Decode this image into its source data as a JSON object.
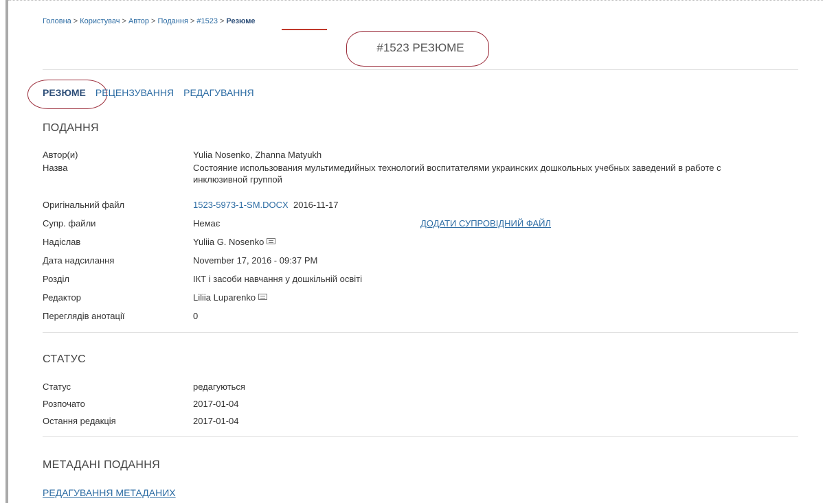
{
  "breadcrumb": {
    "items": [
      "Головна",
      "Користувач",
      "Автор",
      "Подання",
      "#1523"
    ],
    "current": "Резюме"
  },
  "page_title": "#1523 РЕЗЮМЕ",
  "tabs": [
    "РЕЗЮМЕ",
    "РЕЦЕНЗУВАННЯ",
    "РЕДАГУВАННЯ"
  ],
  "submission": {
    "heading": "ПОДАННЯ",
    "authors_label": "Автор(и)",
    "authors": "Yulia Nosenko, Zhanna Matyukh",
    "title_label": "Назва",
    "title": "Состояние использования мультимедийных технологий воспитателями украинских дошкольных учебных заведений в работе с инклюзивной группой",
    "original_file_label": "Оригінальний файл",
    "original_file": "1523-5973-1-SM.DOCX",
    "original_file_date": "2016-11-17",
    "supp_files_label": "Супр. файли",
    "supp_files": "Немає",
    "add_supp_file": "ДОДАТИ СУПРОВІДНИЙ ФАЙЛ",
    "submitter_label": "Надіслав",
    "submitter": "Yuliia G. Nosenko",
    "date_label": "Дата надсилання",
    "date": "November 17, 2016 - 09:37 PM",
    "section_label": "Розділ",
    "section": "ІКТ і засоби навчання у дошкільній освіті",
    "editor_label": "Редактор",
    "editor": "Liliia Luparenko",
    "abstract_views_label": "Переглядів анотації",
    "abstract_views": "0"
  },
  "status": {
    "heading": "СТАТУС",
    "status_label": "Статус",
    "status": "редагуються",
    "started_label": "Розпочато",
    "started": "2017-01-04",
    "last_edit_label": "Остання редакція",
    "last_edit": "2017-01-04"
  },
  "metadata": {
    "heading": "МЕТАДАНІ ПОДАННЯ",
    "edit_link": "РЕДАГУВАННЯ МЕТАДАНИХ"
  },
  "icons": {
    "mail": "mail-icon"
  },
  "colors": {
    "link": "#2e6da4",
    "annotation": "#9b2c3a"
  }
}
